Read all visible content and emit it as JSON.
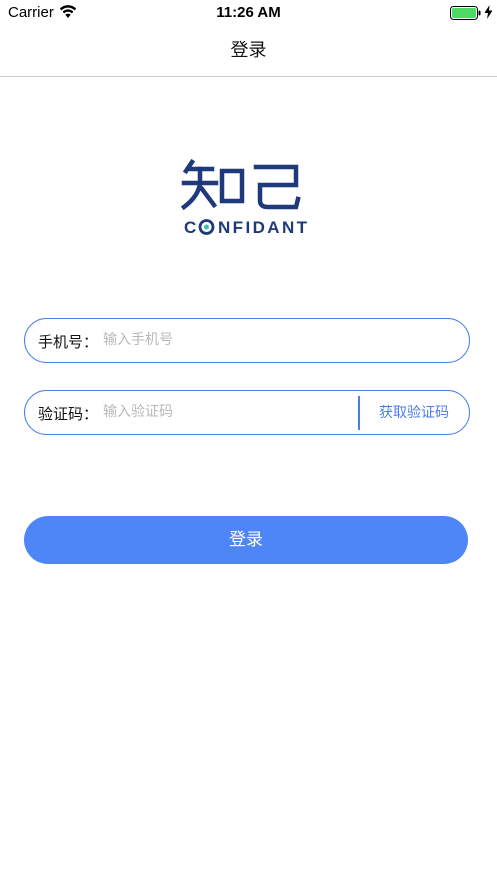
{
  "status_bar": {
    "carrier": "Carrier",
    "time": "11:26 AM"
  },
  "nav": {
    "title": "登录"
  },
  "logo": {
    "chinese": "知己",
    "english": "CONFIDANT",
    "color": "#1f3a7a"
  },
  "phone_field": {
    "label": "手机号：",
    "placeholder": "输入手机号",
    "value": ""
  },
  "code_field": {
    "label": "验证码：",
    "placeholder": "输入验证码",
    "value": "",
    "get_code_label": "获取验证码"
  },
  "login_button": {
    "label": "登录"
  },
  "colors": {
    "accent": "#4a7ee6",
    "button_bg": "#4e86f8",
    "battery": "#4cd964"
  }
}
